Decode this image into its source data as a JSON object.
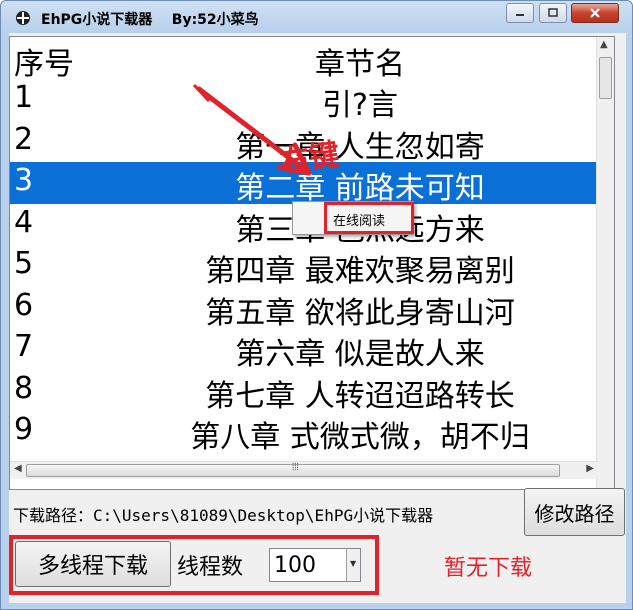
{
  "window": {
    "title": "EhPG小说下载器    By:52小菜鸟"
  },
  "list": {
    "headers": {
      "no": "序号",
      "name": "章节名"
    },
    "rows": [
      {
        "no": "1",
        "name": "引?言"
      },
      {
        "no": "2",
        "name": "第一章 人生忽如寄"
      },
      {
        "no": "3",
        "name": "第二章 前路未可知"
      },
      {
        "no": "4",
        "name": "第三章 岂灬远方来"
      },
      {
        "no": "5",
        "name": "第四章 最难欢聚易离别"
      },
      {
        "no": "6",
        "name": "第五章 欲将此身寄山河"
      },
      {
        "no": "7",
        "name": "第六章 似是故人来"
      },
      {
        "no": "8",
        "name": "第七章 人转迢迢路转长"
      },
      {
        "no": "9",
        "name": "第八章 式微式微，胡不归"
      }
    ],
    "selected_row": "3"
  },
  "context_menu": {
    "item": "在线阅读"
  },
  "annotation": {
    "text": "右键"
  },
  "download_path": "下载路径：C:\\Users\\81089\\Desktop\\EhPG小说下载器",
  "buttons": {
    "change_path": "修改路径",
    "multi_thread": "多线程下载"
  },
  "threads": {
    "label": "线程数",
    "value": "100"
  },
  "status": "暂无下载",
  "colors": {
    "selection": "#0a6fd6",
    "annotation_red": "#e0232a"
  }
}
